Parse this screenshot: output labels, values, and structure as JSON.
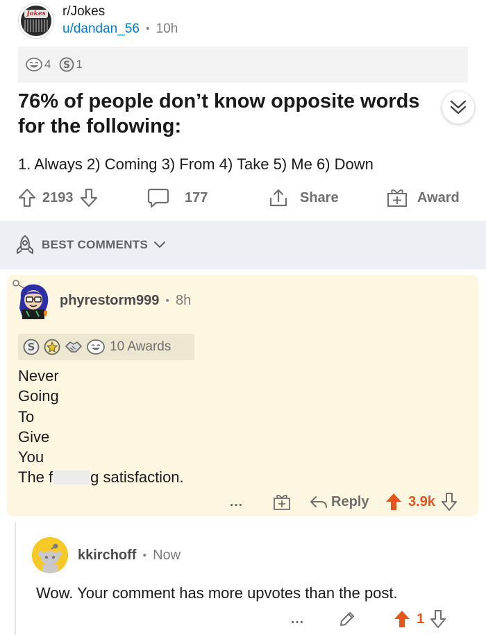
{
  "post": {
    "subreddit": "r/Jokes",
    "subreddit_logo_text": "Jokes",
    "username": "u/dandan_56",
    "separator": "•",
    "age": "10h",
    "awards": [
      {
        "icon": "laughing-face-award-icon",
        "count": "4"
      },
      {
        "icon": "silver-coin-award-icon",
        "count": "1"
      }
    ],
    "title": "76% of people don’t know opposite words for the following:",
    "body": "1. Always 2) Coming 3) From 4) Take 5) Me 6) Down",
    "score": "2193",
    "comments_count": "177",
    "share_label": "Share",
    "award_label": "Award"
  },
  "sort": {
    "label": "BEST COMMENTS"
  },
  "comments": [
    {
      "username": "phyrestorm999",
      "separator": "•",
      "age": "8h",
      "awards_label": "10 Awards",
      "lines": [
        "Never",
        "Going",
        "To",
        "Give",
        "You"
      ],
      "last_line_prefix": "The f",
      "last_line_suffix": "g satisfaction.",
      "more_label": "…",
      "reply_label": "Reply",
      "score": "3.9k"
    },
    {
      "username": "kkirchoff",
      "separator": "•",
      "age": "Now",
      "body": "Wow.  Your comment has more upvotes than the post.",
      "more_label": "…",
      "score": "1"
    }
  ],
  "colors": {
    "upvote_active": "#e5561a",
    "link_blue": "#0079d3",
    "highlight_bg": "#fdf7e1",
    "sort_bar_bg": "#eceff3"
  }
}
